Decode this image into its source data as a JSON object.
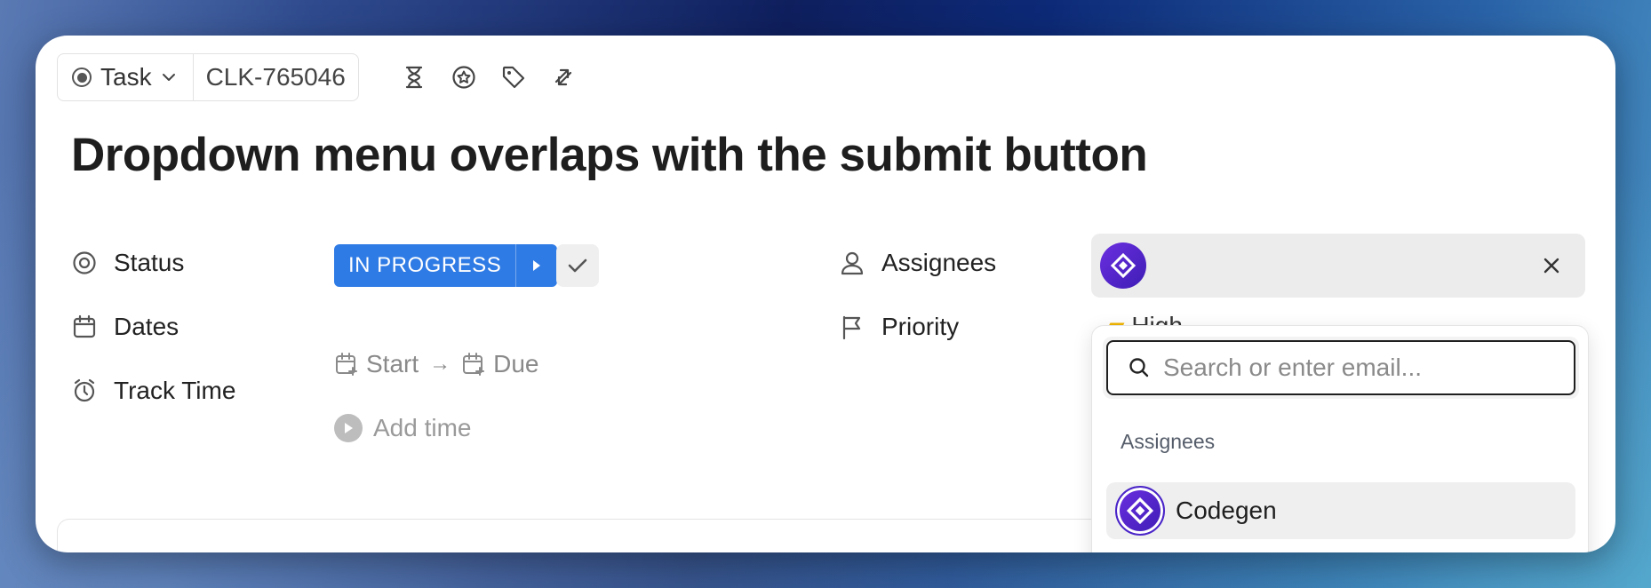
{
  "toolbar": {
    "type_label": "Task",
    "task_id": "CLK-765046",
    "icons": [
      "hourglass-icon",
      "badge-star-icon",
      "tag-icon",
      "sync-icon"
    ]
  },
  "title": "Dropdown menu overlaps with the submit button",
  "fields": {
    "status": {
      "label": "Status",
      "value": "IN PROGRESS",
      "color": "#2f7be5"
    },
    "dates": {
      "label": "Dates",
      "start": "Start",
      "arrow": "→",
      "due": "Due"
    },
    "track_time": {
      "label": "Track Time",
      "value": "Add time"
    },
    "assignees": {
      "label": "Assignees"
    },
    "priority": {
      "label": "Priority",
      "value": "High"
    }
  },
  "dropdown": {
    "search_placeholder": "Search or enter email...",
    "section_label": "Assignees",
    "options": [
      {
        "name": "Codegen"
      }
    ]
  }
}
